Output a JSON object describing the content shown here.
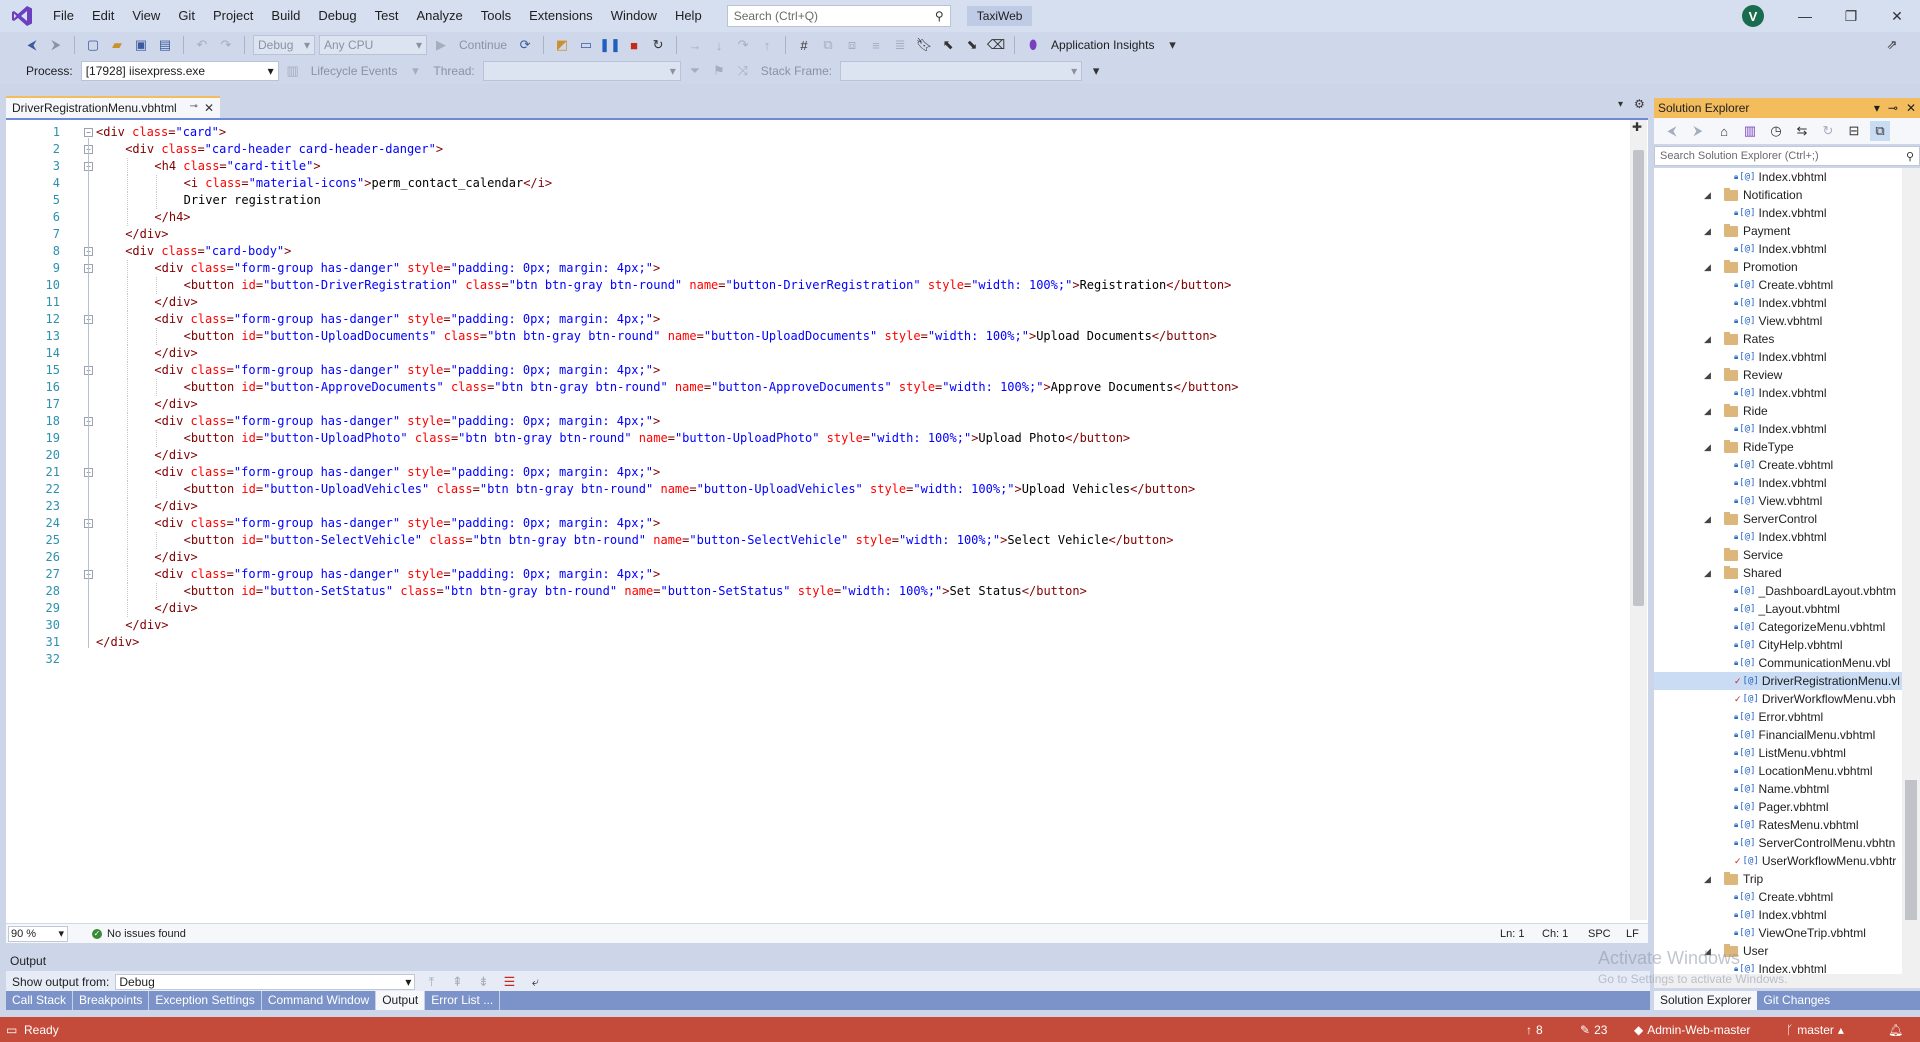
{
  "menubar": {
    "items": [
      "File",
      "Edit",
      "View",
      "Git",
      "Project",
      "Build",
      "Debug",
      "Test",
      "Analyze",
      "Tools",
      "Extensions",
      "Window",
      "Help"
    ],
    "search_placeholder": "Search (Ctrl+Q)",
    "solution_name": "TaxiWeb",
    "avatar_initial": "V"
  },
  "toolbar1": {
    "config": "Debug",
    "platform": "Any CPU",
    "continue_label": "Continue",
    "app_insights": "Application Insights"
  },
  "toolbar2": {
    "process_label": "Process:",
    "process_value": "[17928] iisexpress.exe",
    "lifecycle_label": "Lifecycle Events",
    "thread_label": "Thread:",
    "stackframe_label": "Stack Frame:"
  },
  "editor": {
    "tab_title": "DriverRegistrationMenu.vbhtml",
    "line_count": 32,
    "lines": [
      [
        [
          "t",
          "<div "
        ],
        [
          "a",
          "class"
        ],
        [
          "t",
          "="
        ],
        [
          "v",
          "\"card\""
        ],
        [
          "t",
          ">"
        ]
      ],
      [
        [
          "t",
          "<div "
        ],
        [
          "a",
          "class"
        ],
        [
          "t",
          "="
        ],
        [
          "v",
          "\"card-header card-header-danger\""
        ],
        [
          "t",
          ">"
        ]
      ],
      [
        [
          "t",
          "<h4 "
        ],
        [
          "a",
          "class"
        ],
        [
          "t",
          "="
        ],
        [
          "v",
          "\"card-title\""
        ],
        [
          "t",
          ">"
        ]
      ],
      [
        [
          "t",
          "<i "
        ],
        [
          "a",
          "class"
        ],
        [
          "t",
          "="
        ],
        [
          "v",
          "\"material-icons\""
        ],
        [
          "t",
          ">"
        ],
        [
          "x",
          "perm_contact_calendar"
        ],
        [
          "t",
          "</i>"
        ]
      ],
      [
        [
          "x",
          "Driver registration"
        ]
      ],
      [
        [
          "t",
          "</h4>"
        ]
      ],
      [
        [
          "t",
          "</div>"
        ]
      ],
      [
        [
          "t",
          "<div "
        ],
        [
          "a",
          "class"
        ],
        [
          "t",
          "="
        ],
        [
          "v",
          "\"card-body\""
        ],
        [
          "t",
          ">"
        ]
      ],
      [
        [
          "t",
          "<div "
        ],
        [
          "a",
          "class"
        ],
        [
          "t",
          "="
        ],
        [
          "v",
          "\"form-group has-danger\""
        ],
        [
          "x",
          " "
        ],
        [
          "a",
          "style"
        ],
        [
          "t",
          "="
        ],
        [
          "v",
          "\"padding: 0px; margin: 4px;\""
        ],
        [
          "t",
          ">"
        ]
      ],
      [
        [
          "t",
          "<button "
        ],
        [
          "a",
          "id"
        ],
        [
          "t",
          "="
        ],
        [
          "v",
          "\"button-DriverRegistration\""
        ],
        [
          "x",
          " "
        ],
        [
          "a",
          "class"
        ],
        [
          "t",
          "="
        ],
        [
          "v",
          "\"btn btn-gray btn-round\""
        ],
        [
          "x",
          " "
        ],
        [
          "a",
          "name"
        ],
        [
          "t",
          "="
        ],
        [
          "v",
          "\"button-DriverRegistration\""
        ],
        [
          "x",
          " "
        ],
        [
          "a",
          "style"
        ],
        [
          "t",
          "="
        ],
        [
          "v",
          "\"width: 100%;\""
        ],
        [
          "t",
          ">"
        ],
        [
          "x",
          "Registration"
        ],
        [
          "t",
          "</button>"
        ]
      ],
      [
        [
          "t",
          "</div>"
        ]
      ],
      [
        [
          "t",
          "<div "
        ],
        [
          "a",
          "class"
        ],
        [
          "t",
          "="
        ],
        [
          "v",
          "\"form-group has-danger\""
        ],
        [
          "x",
          " "
        ],
        [
          "a",
          "style"
        ],
        [
          "t",
          "="
        ],
        [
          "v",
          "\"padding: 0px; margin: 4px;\""
        ],
        [
          "t",
          ">"
        ]
      ],
      [
        [
          "t",
          "<button "
        ],
        [
          "a",
          "id"
        ],
        [
          "t",
          "="
        ],
        [
          "v",
          "\"button-UploadDocuments\""
        ],
        [
          "x",
          " "
        ],
        [
          "a",
          "class"
        ],
        [
          "t",
          "="
        ],
        [
          "v",
          "\"btn btn-gray btn-round\""
        ],
        [
          "x",
          " "
        ],
        [
          "a",
          "name"
        ],
        [
          "t",
          "="
        ],
        [
          "v",
          "\"button-UploadDocuments\""
        ],
        [
          "x",
          " "
        ],
        [
          "a",
          "style"
        ],
        [
          "t",
          "="
        ],
        [
          "v",
          "\"width: 100%;\""
        ],
        [
          "t",
          ">"
        ],
        [
          "x",
          "Upload Documents"
        ],
        [
          "t",
          "</button>"
        ]
      ],
      [
        [
          "t",
          "</div>"
        ]
      ],
      [
        [
          "t",
          "<div "
        ],
        [
          "a",
          "class"
        ],
        [
          "t",
          "="
        ],
        [
          "v",
          "\"form-group has-danger\""
        ],
        [
          "x",
          " "
        ],
        [
          "a",
          "style"
        ],
        [
          "t",
          "="
        ],
        [
          "v",
          "\"padding: 0px; margin: 4px;\""
        ],
        [
          "t",
          ">"
        ]
      ],
      [
        [
          "t",
          "<button "
        ],
        [
          "a",
          "id"
        ],
        [
          "t",
          "="
        ],
        [
          "v",
          "\"button-ApproveDocuments\""
        ],
        [
          "x",
          " "
        ],
        [
          "a",
          "class"
        ],
        [
          "t",
          "="
        ],
        [
          "v",
          "\"btn btn-gray btn-round\""
        ],
        [
          "x",
          " "
        ],
        [
          "a",
          "name"
        ],
        [
          "t",
          "="
        ],
        [
          "v",
          "\"button-ApproveDocuments\""
        ],
        [
          "x",
          " "
        ],
        [
          "a",
          "style"
        ],
        [
          "t",
          "="
        ],
        [
          "v",
          "\"width: 100%;\""
        ],
        [
          "t",
          ">"
        ],
        [
          "x",
          "Approve Documents"
        ],
        [
          "t",
          "</button>"
        ]
      ],
      [
        [
          "t",
          "</div>"
        ]
      ],
      [
        [
          "t",
          "<div "
        ],
        [
          "a",
          "class"
        ],
        [
          "t",
          "="
        ],
        [
          "v",
          "\"form-group has-danger\""
        ],
        [
          "x",
          " "
        ],
        [
          "a",
          "style"
        ],
        [
          "t",
          "="
        ],
        [
          "v",
          "\"padding: 0px; margin: 4px;\""
        ],
        [
          "t",
          ">"
        ]
      ],
      [
        [
          "t",
          "<button "
        ],
        [
          "a",
          "id"
        ],
        [
          "t",
          "="
        ],
        [
          "v",
          "\"button-UploadPhoto\""
        ],
        [
          "x",
          " "
        ],
        [
          "a",
          "class"
        ],
        [
          "t",
          "="
        ],
        [
          "v",
          "\"btn btn-gray btn-round\""
        ],
        [
          "x",
          " "
        ],
        [
          "a",
          "name"
        ],
        [
          "t",
          "="
        ],
        [
          "v",
          "\"button-UploadPhoto\""
        ],
        [
          "x",
          " "
        ],
        [
          "a",
          "style"
        ],
        [
          "t",
          "="
        ],
        [
          "v",
          "\"width: 100%;\""
        ],
        [
          "t",
          ">"
        ],
        [
          "x",
          "Upload Photo"
        ],
        [
          "t",
          "</button>"
        ]
      ],
      [
        [
          "t",
          "</div>"
        ]
      ],
      [
        [
          "t",
          "<div "
        ],
        [
          "a",
          "class"
        ],
        [
          "t",
          "="
        ],
        [
          "v",
          "\"form-group has-danger\""
        ],
        [
          "x",
          " "
        ],
        [
          "a",
          "style"
        ],
        [
          "t",
          "="
        ],
        [
          "v",
          "\"padding: 0px; margin: 4px;\""
        ],
        [
          "t",
          ">"
        ]
      ],
      [
        [
          "t",
          "<button "
        ],
        [
          "a",
          "id"
        ],
        [
          "t",
          "="
        ],
        [
          "v",
          "\"button-UploadVehicles\""
        ],
        [
          "x",
          " "
        ],
        [
          "a",
          "class"
        ],
        [
          "t",
          "="
        ],
        [
          "v",
          "\"btn btn-gray btn-round\""
        ],
        [
          "x",
          " "
        ],
        [
          "a",
          "name"
        ],
        [
          "t",
          "="
        ],
        [
          "v",
          "\"button-UploadVehicles\""
        ],
        [
          "x",
          " "
        ],
        [
          "a",
          "style"
        ],
        [
          "t",
          "="
        ],
        [
          "v",
          "\"width: 100%;\""
        ],
        [
          "t",
          ">"
        ],
        [
          "x",
          "Upload Vehicles"
        ],
        [
          "t",
          "</button>"
        ]
      ],
      [
        [
          "t",
          "</div>"
        ]
      ],
      [
        [
          "t",
          "<div "
        ],
        [
          "a",
          "class"
        ],
        [
          "t",
          "="
        ],
        [
          "v",
          "\"form-group has-danger\""
        ],
        [
          "x",
          " "
        ],
        [
          "a",
          "style"
        ],
        [
          "t",
          "="
        ],
        [
          "v",
          "\"padding: 0px; margin: 4px;\""
        ],
        [
          "t",
          ">"
        ]
      ],
      [
        [
          "t",
          "<button "
        ],
        [
          "a",
          "id"
        ],
        [
          "t",
          "="
        ],
        [
          "v",
          "\"button-SelectVehicle\""
        ],
        [
          "x",
          " "
        ],
        [
          "a",
          "class"
        ],
        [
          "t",
          "="
        ],
        [
          "v",
          "\"btn btn-gray btn-round\""
        ],
        [
          "x",
          " "
        ],
        [
          "a",
          "name"
        ],
        [
          "t",
          "="
        ],
        [
          "v",
          "\"button-SelectVehicle\""
        ],
        [
          "x",
          " "
        ],
        [
          "a",
          "style"
        ],
        [
          "t",
          "="
        ],
        [
          "v",
          "\"width: 100%;\""
        ],
        [
          "t",
          ">"
        ],
        [
          "x",
          "Select Vehicle"
        ],
        [
          "t",
          "</button>"
        ]
      ],
      [
        [
          "t",
          "</div>"
        ]
      ],
      [
        [
          "t",
          "<div "
        ],
        [
          "a",
          "class"
        ],
        [
          "t",
          "="
        ],
        [
          "v",
          "\"form-group has-danger\""
        ],
        [
          "x",
          " "
        ],
        [
          "a",
          "style"
        ],
        [
          "t",
          "="
        ],
        [
          "v",
          "\"padding: 0px; margin: 4px;\""
        ],
        [
          "t",
          ">"
        ]
      ],
      [
        [
          "t",
          "<button "
        ],
        [
          "a",
          "id"
        ],
        [
          "t",
          "="
        ],
        [
          "v",
          "\"button-SetStatus\""
        ],
        [
          "x",
          " "
        ],
        [
          "a",
          "class"
        ],
        [
          "t",
          "="
        ],
        [
          "v",
          "\"btn btn-gray btn-round\""
        ],
        [
          "x",
          " "
        ],
        [
          "a",
          "name"
        ],
        [
          "t",
          "="
        ],
        [
          "v",
          "\"button-SetStatus\""
        ],
        [
          "x",
          " "
        ],
        [
          "a",
          "style"
        ],
        [
          "t",
          "="
        ],
        [
          "v",
          "\"width: 100%;\""
        ],
        [
          "t",
          ">"
        ],
        [
          "x",
          "Set Status"
        ],
        [
          "t",
          "</button>"
        ]
      ],
      [
        [
          "t",
          "</div>"
        ]
      ],
      [
        [
          "t",
          "</div>"
        ]
      ],
      [
        [
          "t",
          "</div>"
        ]
      ],
      []
    ],
    "zoom": "90 %",
    "issues": "No issues found",
    "position_ln": "Ln: 1",
    "position_ch": "Ch: 1",
    "whitespace": "SPC",
    "line_ending": "LF"
  },
  "output": {
    "title": "Output",
    "show_from_label": "Show output from:",
    "source": "Debug"
  },
  "bottom_tabs": [
    "Call Stack",
    "Breakpoints",
    "Exception Settings",
    "Command Window",
    "Output",
    "Error List ..."
  ],
  "solution_explorer": {
    "title": "Solution Explorer",
    "search_placeholder": "Search Solution Explorer (Ctrl+;)",
    "items": [
      {
        "type": "file",
        "name": "Index.vbhtml"
      },
      {
        "type": "folder",
        "name": "Notification"
      },
      {
        "type": "file",
        "name": "Index.vbhtml"
      },
      {
        "type": "folder",
        "name": "Payment"
      },
      {
        "type": "file",
        "name": "Index.vbhtml"
      },
      {
        "type": "folder",
        "name": "Promotion"
      },
      {
        "type": "file",
        "name": "Create.vbhtml"
      },
      {
        "type": "file",
        "name": "Index.vbhtml"
      },
      {
        "type": "file",
        "name": "View.vbhtml"
      },
      {
        "type": "folder",
        "name": "Rates"
      },
      {
        "type": "file",
        "name": "Index.vbhtml"
      },
      {
        "type": "folder",
        "name": "Review"
      },
      {
        "type": "file",
        "name": "Index.vbhtml"
      },
      {
        "type": "folder",
        "name": "Ride"
      },
      {
        "type": "file",
        "name": "Index.vbhtml"
      },
      {
        "type": "folder",
        "name": "RideType"
      },
      {
        "type": "file",
        "name": "Create.vbhtml"
      },
      {
        "type": "file",
        "name": "Index.vbhtml"
      },
      {
        "type": "file",
        "name": "View.vbhtml"
      },
      {
        "type": "folder",
        "name": "ServerControl"
      },
      {
        "type": "file",
        "name": "Index.vbhtml"
      },
      {
        "type": "folder-closed",
        "name": "Service"
      },
      {
        "type": "folder",
        "name": "Shared"
      },
      {
        "type": "file",
        "name": "_DashboardLayout.vbhtm"
      },
      {
        "type": "file",
        "name": "_Layout.vbhtml"
      },
      {
        "type": "file",
        "name": "CategorizeMenu.vbhtml"
      },
      {
        "type": "file",
        "name": "CityHelp.vbhtml"
      },
      {
        "type": "file",
        "name": "CommunicationMenu.vbl"
      },
      {
        "type": "file-mod",
        "name": "DriverRegistrationMenu.vl",
        "selected": true
      },
      {
        "type": "file-mod",
        "name": "DriverWorkflowMenu.vbh"
      },
      {
        "type": "file",
        "name": "Error.vbhtml"
      },
      {
        "type": "file",
        "name": "FinancialMenu.vbhtml"
      },
      {
        "type": "file",
        "name": "ListMenu.vbhtml"
      },
      {
        "type": "file",
        "name": "LocationMenu.vbhtml"
      },
      {
        "type": "file",
        "name": "Name.vbhtml"
      },
      {
        "type": "file",
        "name": "Pager.vbhtml"
      },
      {
        "type": "file",
        "name": "RatesMenu.vbhtml"
      },
      {
        "type": "file",
        "name": "ServerControlMenu.vbhtn"
      },
      {
        "type": "file-mod",
        "name": "UserWorkflowMenu.vbhtr"
      },
      {
        "type": "folder",
        "name": "Trip"
      },
      {
        "type": "file",
        "name": "Create.vbhtml"
      },
      {
        "type": "file",
        "name": "Index.vbhtml"
      },
      {
        "type": "file",
        "name": "ViewOneTrip.vbhtml"
      },
      {
        "type": "folder",
        "name": "User"
      },
      {
        "type": "file",
        "name": "Index.vbhtml"
      }
    ],
    "tabs": [
      "Solution Explorer",
      "Git Changes"
    ]
  },
  "watermark": {
    "line1": "Activate Windows",
    "line2": "Go to Settings to activate Windows."
  },
  "statusbar": {
    "ready": "Ready",
    "up_count": "8",
    "pencil_count": "23",
    "repo": "Admin-Web-master",
    "branch": "master"
  },
  "colors": {
    "tag": "#800000",
    "attr": "#ff0000",
    "value": "#0000ff",
    "linenumber": "#2b91af",
    "statusbar": "#c44a3a",
    "active_tab": "#f3bd5d"
  }
}
